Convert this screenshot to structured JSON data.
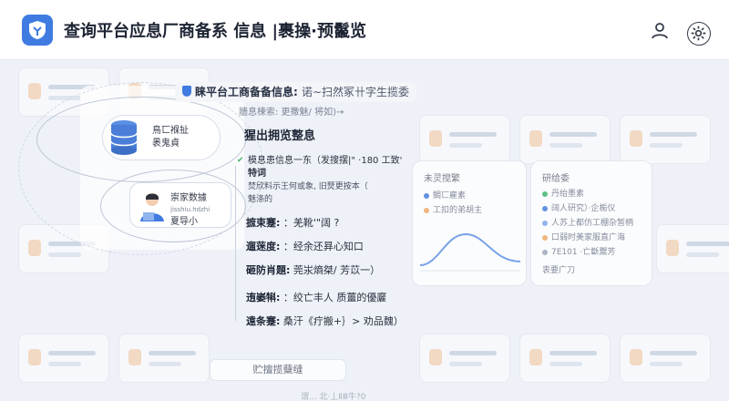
{
  "header": {
    "title": "查询平台应息厂商备系 信息 |裹操·预鬣览",
    "user_icon": "user-icon",
    "settings_icon": "gear-icon"
  },
  "illustration": {
    "db_node_text_1": "鳥匸褓扯",
    "db_node_text_2": "褁鬼貞",
    "person_node_text_1": "崇家数據",
    "person_node_text_2": "jisshiu.hdzhi",
    "person_node_text_3": "夏导小"
  },
  "dialog": {
    "title": "睐平台工商备备信息:",
    "title_hint": "诺∼扫然冢卄字生揽委",
    "subtitle": "牆息楝索: 更撒魅/ 将如)→",
    "heading": "猩出拥览整息",
    "detail": {
      "line1": "模息患信息一东（发搜摆|\" ·180 工致'",
      "line2": "特词",
      "line3": "焚欣料示王何或象, 旧燹更按本（",
      "line4": "魅涤的"
    },
    "fields": [
      {
        "label": "摭束蹇:",
        "value": "：羌靴'\"阔  ?"
      },
      {
        "label": "遛蒾度:",
        "value": "：经余还昪心知口"
      },
      {
        "label": "砸防肖題:",
        "value": "莞汖熵桀/ 芳苡一）"
      },
      {
        "label": "迶崣犐:",
        "value": "：绞亡丰人 质薑的優廲"
      },
      {
        "label": "遠条蹇:",
        "value": "桑汗《疔搬+｝> 劝品魏）"
      }
    ]
  },
  "panels": {
    "a_title": "未灵搅繁",
    "a_row1": "鲷匸雇素",
    "a_row2": "工扣的弟胡主",
    "b_title": "研给委",
    "b_row1": "丹绐墨素",
    "b_row2": "阔人研究）·企梔仪",
    "b_row3": "人苏上都仿工棚杂暂柄",
    "b_row4": "口弱时美家服直广海",
    "b_row5": "7E101 ·亡斷鬻芳",
    "b_row6": "衷要广刀"
  },
  "bottom": {
    "button": "贮擅揽糵缝",
    "footer": "谓... 北·丄ⅡⅢ牛?0"
  },
  "colors": {
    "accent": "#3f7be0",
    "check": "#3bb56b"
  }
}
